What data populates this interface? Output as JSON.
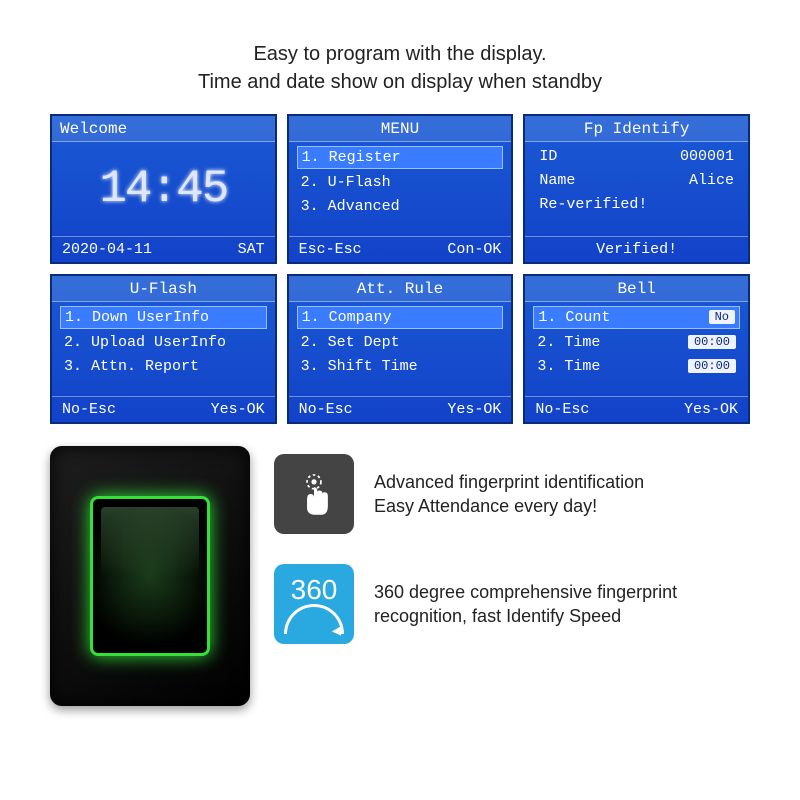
{
  "header": {
    "line1": "Easy to program with the display.",
    "line2": "Time and date show on display when standby"
  },
  "screens": {
    "welcome": {
      "title": "Welcome",
      "time": "14:45",
      "date": "2020-04-11",
      "weekday": "SAT"
    },
    "menu": {
      "title": "MENU",
      "items": [
        "1. Register",
        "2. U-Flash",
        "3. Advanced"
      ],
      "esc": "Esc-Esc",
      "ok": "Con-OK"
    },
    "fp": {
      "title": "Fp Identify",
      "id_label": "ID",
      "id_value": "000001",
      "name_label": "Name",
      "name_value": "Alice",
      "reverified": "Re-verified!",
      "footer": "Verified!"
    },
    "uflash": {
      "title": "U-Flash",
      "items": [
        "1. Down UserInfo",
        "2. Upload UserInfo",
        "3. Attn. Report"
      ],
      "esc": "No-Esc",
      "ok": "Yes-OK"
    },
    "attrule": {
      "title": "Att. Rule",
      "items": [
        {
          "label": "1. Company",
          "value": ""
        },
        {
          "label": "2. Set Dept",
          "value": null
        },
        {
          "label": "3. Shift Time",
          "value": null
        }
      ],
      "esc": "No-Esc",
      "ok": "Yes-OK"
    },
    "bell": {
      "title": "Bell",
      "items": [
        {
          "label": "1. Count",
          "value": "No"
        },
        {
          "label": "2. Time",
          "value": "00:00"
        },
        {
          "label": "3. Time",
          "value": "00:00"
        }
      ],
      "esc": "No-Esc",
      "ok": "Yes-OK"
    }
  },
  "features": {
    "f1": {
      "line1": "Advanced fingerprint identification",
      "line2": "Easy Attendance every day!"
    },
    "f2": {
      "badge": "360",
      "line1": "360 degree comprehensive fingerprint",
      "line2": "recognition, fast Identify Speed"
    }
  }
}
